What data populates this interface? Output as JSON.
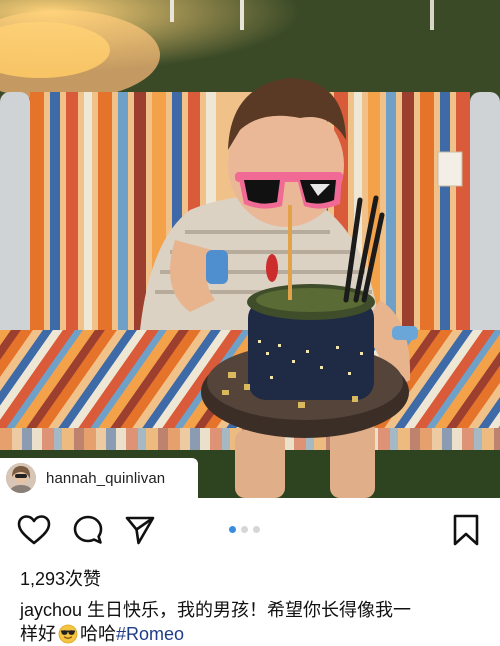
{
  "post": {
    "tagged_user": "hannah_quinlivan",
    "likes_text": "1,293次赞",
    "caption": {
      "username": "jaychou",
      "text_line1": " 生日快乐，我的男孩！希望你长得像我一",
      "text_line2": "样好",
      "emoji": "sunglasses-face",
      "suffix": "哈哈",
      "hashtag": "#Romeo"
    },
    "carousel": {
      "current": 1,
      "total": 3
    }
  },
  "icons": {
    "like": "heart-icon",
    "comment": "comment-icon",
    "share": "send-icon",
    "save": "bookmark-icon"
  },
  "colors": {
    "active_dot": "#3a8dde",
    "inactive_dot": "#d6d6d6",
    "hashtag": "#1f3c88"
  }
}
